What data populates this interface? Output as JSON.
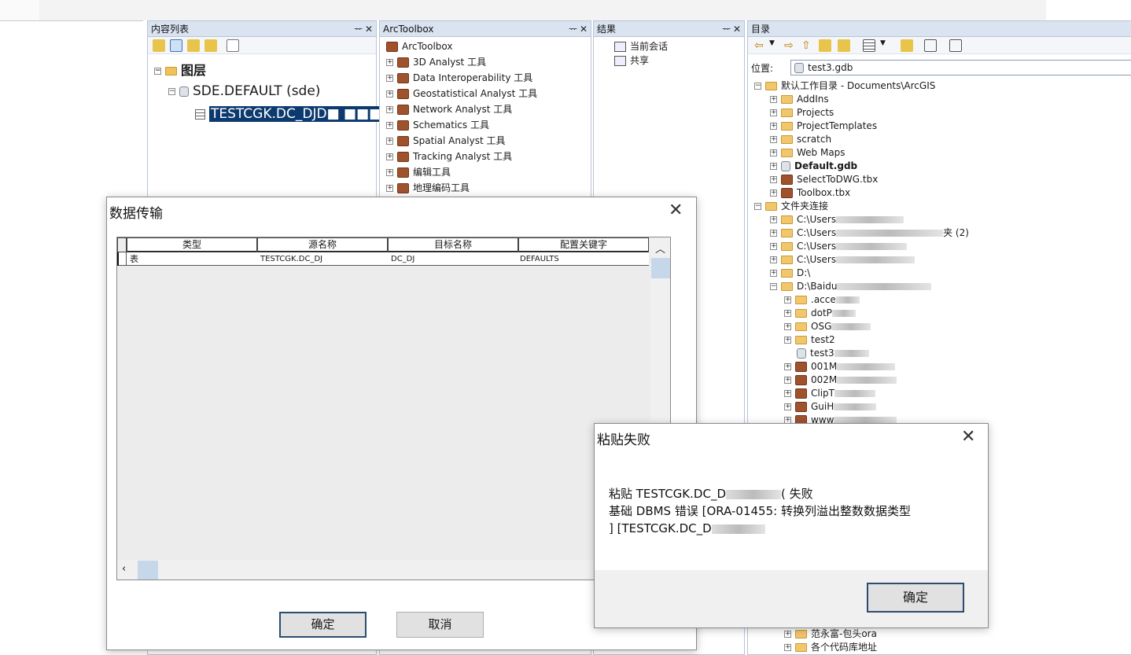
{
  "panels": {
    "toc": {
      "title": "内容列表",
      "layers_label": "图层",
      "db_label": "SDE.DEFAULT (sde)",
      "layer_label": "TESTCGK.DC_DJD",
      "layer_suffix_obscured": "■ ■■■"
    },
    "toolbox": {
      "title": "ArcToolbox",
      "root": "ArcToolbox",
      "items": [
        "3D Analyst 工具",
        "Data Interoperability 工具",
        "Geostatistical Analyst 工具",
        "Network Analyst 工具",
        "Schematics 工具",
        "Spatial Analyst 工具",
        "Tracking Analyst 工具",
        "编辑工具",
        "地理编码工具"
      ]
    },
    "results": {
      "title": "结果",
      "items": [
        "当前会话",
        "共享"
      ]
    },
    "catalog": {
      "title": "目录",
      "location_label": "位置:",
      "location_value": "test3.gdb",
      "root_home": "默认工作目录 - Documents\\ArcGIS",
      "home_children": [
        "AddIns",
        "Projects",
        "ProjectTemplates",
        "scratch",
        "Web Maps",
        "Default.gdb",
        "SelectToDWG.tbx",
        "Toolbox.tbx"
      ],
      "folder_connections": "文件夹连接",
      "connections": [
        "C:\\Users",
        "C:\\Users",
        "C:\\Users",
        "C:\\Users",
        "D:\\",
        "D:\\Baidu"
      ],
      "connection_suffix_2": "夹 (2)",
      "baidu_children": [
        ".acce",
        "dotP",
        "OSG",
        "test2",
        "test3",
        "001M",
        "002M",
        "ClipT",
        "GuiH",
        "www"
      ],
      "bottom_items": [
        "范永富-包头ora",
        "各个代码库地址"
      ]
    }
  },
  "transfer_dialog": {
    "title": "数据传输",
    "columns": [
      "类型",
      "源名称",
      "目标名称",
      "配置关键字"
    ],
    "row": {
      "type": "表",
      "source": "TESTCGK.DC_DJ",
      "target": "DC_DJ",
      "keyword": "DEFAULTS"
    },
    "ok_label": "确定",
    "cancel_label": "取消"
  },
  "error_dialog": {
    "title": "粘贴失败",
    "line1": "粘贴 TESTCGK.DC_D",
    "line1_suffix": "( 失败",
    "line2": "基础 DBMS 错误 [ORA-01455: 转换列溢出整数数据类型",
    "line3": "] [TESTCGK.DC_D",
    "ok_label": "确定"
  },
  "colors": {
    "panel_header": "#dae4f1",
    "selection": "#0d3a6e",
    "button_border": "#2c4d6f",
    "scroll_thumb": "#c7d7ea"
  },
  "icons": [
    "pin-icon",
    "close-icon",
    "back-arrow-icon",
    "forward-arrow-icon",
    "up-folder-icon",
    "home-icon",
    "connect-folder-icon",
    "view-options-icon",
    "toc-options-icon",
    "folder-icon",
    "toolbox-icon",
    "geodatabase-icon",
    "table-icon",
    "scroll-up-icon",
    "scroll-left-icon"
  ]
}
